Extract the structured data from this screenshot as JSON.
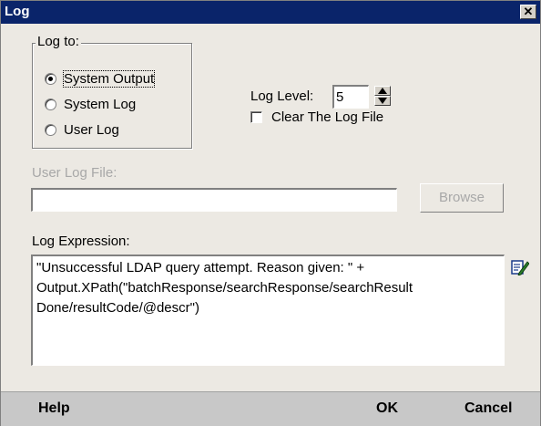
{
  "window": {
    "title": "Log",
    "close_glyph": "✕"
  },
  "log_to": {
    "legend": "Log to:",
    "options": [
      {
        "label": "System Output",
        "checked": true
      },
      {
        "label": "System Log",
        "checked": false
      },
      {
        "label": "User Log",
        "checked": false
      }
    ]
  },
  "log_level": {
    "label": "Log Level:",
    "value": "5"
  },
  "clear_log": {
    "label": "Clear The Log File",
    "checked": false
  },
  "user_log_file": {
    "label": "User Log File:",
    "value": "",
    "browse_label": "Browse"
  },
  "log_expression": {
    "label": "Log Expression:",
    "value": "\"Unsuccessful LDAP query attempt. Reason given: \" +\nOutput.XPath(\"batchResponse/searchResponse/searchResult\nDone/resultCode/@descr\")",
    "edit_icon": "edit-expression-icon"
  },
  "footer": {
    "help": "Help",
    "ok": "OK",
    "cancel": "Cancel"
  },
  "colors": {
    "titlebar": "#0a246a",
    "dialog_bg": "#ece9e3",
    "footer_bg": "#c8c8c8",
    "disabled_text": "#a8a8a8"
  }
}
